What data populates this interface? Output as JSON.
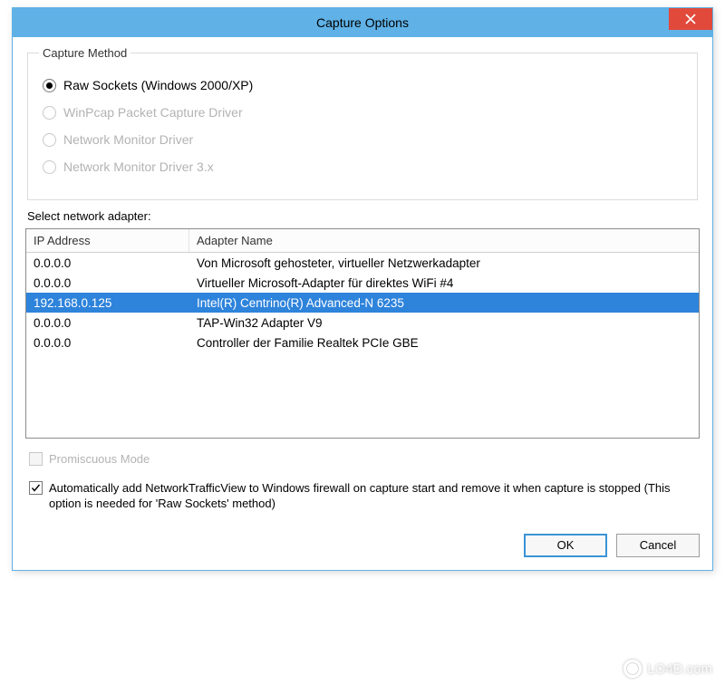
{
  "window": {
    "title": "Capture Options"
  },
  "captureMethod": {
    "legend": "Capture Method",
    "options": [
      {
        "label": "Raw Sockets (Windows 2000/XP)",
        "selected": true,
        "enabled": true
      },
      {
        "label": "WinPcap Packet Capture Driver",
        "selected": false,
        "enabled": false
      },
      {
        "label": "Network Monitor Driver",
        "selected": false,
        "enabled": false
      },
      {
        "label": "Network Monitor Driver 3.x",
        "selected": false,
        "enabled": false
      }
    ]
  },
  "adapterSection": {
    "label": "Select network adapter:",
    "columns": {
      "ip": "IP Address",
      "name": "Adapter Name"
    },
    "rows": [
      {
        "ip": "0.0.0.0",
        "name": "Von Microsoft gehosteter, virtueller Netzwerkadapter",
        "selected": false
      },
      {
        "ip": "0.0.0.0",
        "name": "Virtueller Microsoft-Adapter für direktes WiFi #4",
        "selected": false
      },
      {
        "ip": "192.168.0.125",
        "name": "Intel(R) Centrino(R) Advanced-N 6235",
        "selected": true
      },
      {
        "ip": "0.0.0.0",
        "name": "TAP-Win32 Adapter V9",
        "selected": false
      },
      {
        "ip": "0.0.0.0",
        "name": "Controller der Familie Realtek PCIe GBE",
        "selected": false
      }
    ]
  },
  "checks": {
    "promiscuous": {
      "label": "Promiscuous Mode",
      "checked": false,
      "enabled": false
    },
    "firewall": {
      "label": "Automatically add NetworkTrafficView to Windows firewall on capture start and remove it when capture is stopped (This option is needed for 'Raw Sockets' method)",
      "checked": true,
      "enabled": true
    }
  },
  "buttons": {
    "ok": "OK",
    "cancel": "Cancel"
  },
  "watermark": "LO4D.com"
}
